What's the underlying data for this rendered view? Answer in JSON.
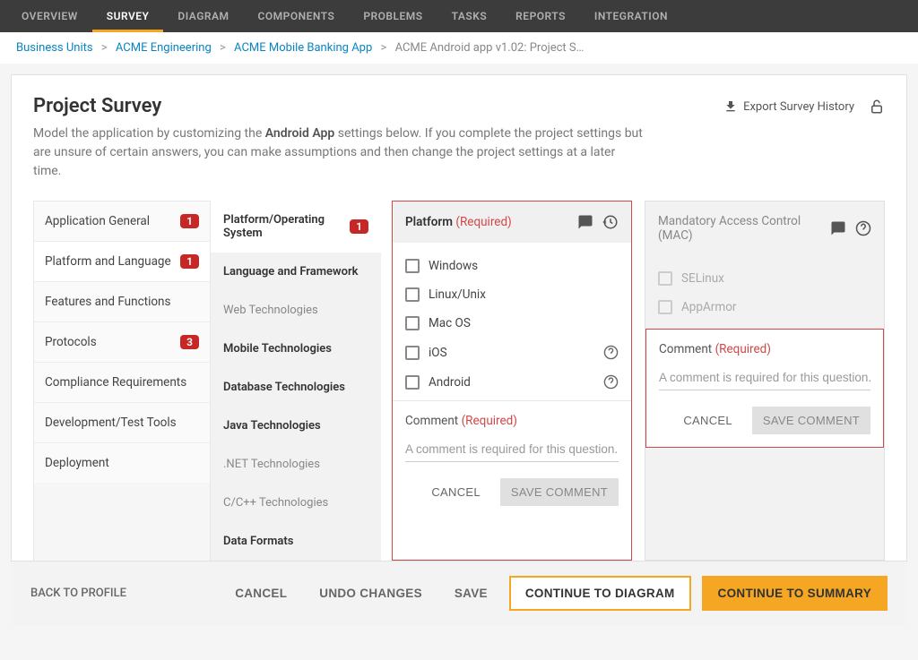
{
  "topnav": {
    "tabs": [
      "OVERVIEW",
      "SURVEY",
      "DIAGRAM",
      "COMPONENTS",
      "PROBLEMS",
      "TASKS",
      "REPORTS",
      "INTEGRATION"
    ],
    "active_index": 1
  },
  "breadcrumb": {
    "items": [
      "Business Units",
      "ACME Engineering",
      "ACME Mobile Banking App"
    ],
    "current": "ACME Android app v1.02: Project S…"
  },
  "header": {
    "title": "Project Survey",
    "subtitle_prefix": "Model the application by customizing the ",
    "subtitle_bold": "Android App",
    "subtitle_suffix": " settings below. If you complete the project settings but are unsure of certain answers, you can make assumptions and then change the project settings at a later time.",
    "export_label": "Export Survey History"
  },
  "leftnav": {
    "items": [
      {
        "label": "Application General",
        "badge": "1"
      },
      {
        "label": "Platform and Language",
        "badge": "1"
      },
      {
        "label": "Features and Functions"
      },
      {
        "label": "Protocols",
        "badge": "3"
      },
      {
        "label": "Compliance Requirements"
      },
      {
        "label": "Development/Test Tools"
      },
      {
        "label": "Deployment"
      }
    ],
    "active_index": 1
  },
  "subnav": {
    "items": [
      {
        "label": "Platform/Operating System",
        "badge": "1",
        "style": "active"
      },
      {
        "label": "Language and Framework",
        "style": "dark"
      },
      {
        "label": "Web Technologies",
        "style": "muted"
      },
      {
        "label": "Mobile Technologies",
        "style": "dark"
      },
      {
        "label": "Database Technologies",
        "style": "dark"
      },
      {
        "label": "Java Technologies",
        "style": "dark"
      },
      {
        "label": ".NET Technologies",
        "style": "muted"
      },
      {
        "label": "C/C++ Technologies",
        "style": "muted"
      },
      {
        "label": "Data Formats",
        "style": "dark"
      }
    ]
  },
  "platform_card": {
    "title": "Platform",
    "required": "(Required)",
    "options": [
      {
        "label": "Windows",
        "help": false
      },
      {
        "label": "Linux/Unix",
        "help": false
      },
      {
        "label": "Mac OS",
        "help": false
      },
      {
        "label": "iOS",
        "help": true
      },
      {
        "label": "Android",
        "help": true
      }
    ],
    "comment_label": "Comment",
    "comment_required": "(Required)",
    "comment_placeholder": "A comment is required for this question...",
    "cancel": "CANCEL",
    "save": "SAVE COMMENT"
  },
  "mac_card": {
    "title": "Mandatory Access Control (MAC)",
    "options": [
      {
        "label": "SELinux"
      },
      {
        "label": "AppArmor"
      }
    ],
    "comment_label": "Comment",
    "comment_required": "(Required)",
    "comment_placeholder": "A comment is required for this question...",
    "cancel": "CANCEL",
    "save": "SAVE COMMENT"
  },
  "footer": {
    "back": "BACK TO PROFILE",
    "cancel": "CANCEL",
    "undo": "UNDO CHANGES",
    "save": "SAVE",
    "continue_diagram": "CONTINUE TO DIAGRAM",
    "continue_summary": "CONTINUE TO SUMMARY"
  }
}
